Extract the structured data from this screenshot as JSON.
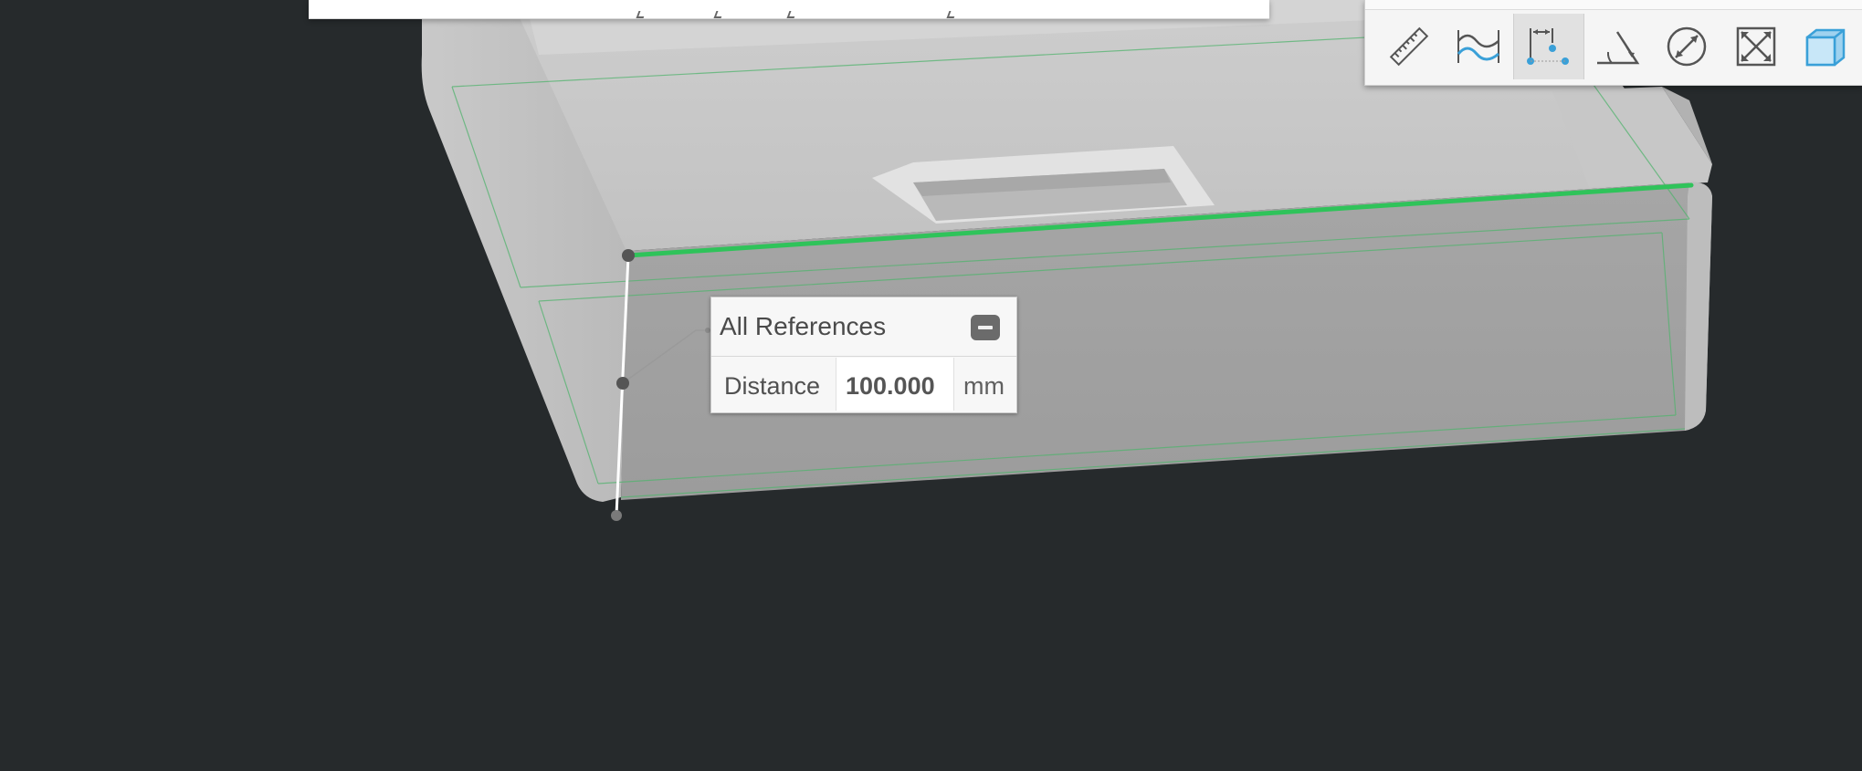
{
  "measure_panel": {
    "title": "All References",
    "distance_label": "Distance",
    "distance_value": "100.000",
    "distance_unit": "mm"
  },
  "toolbar": {
    "tools": [
      {
        "name": "ruler-tool",
        "icon": "ruler-icon"
      },
      {
        "name": "curve-measure-tool",
        "icon": "curve-icon"
      },
      {
        "name": "distance-measure-tool",
        "icon": "point-distance-icon",
        "active": true
      },
      {
        "name": "angle-measure-tool",
        "icon": "angle-icon"
      },
      {
        "name": "diameter-measure-tool",
        "icon": "diameter-icon"
      },
      {
        "name": "fit-view-tool",
        "icon": "fit-expand-icon"
      },
      {
        "name": "view-cube-tool",
        "icon": "cube-icon"
      }
    ]
  },
  "colors": {
    "background": "#262a2c",
    "model": "#b9b9b9",
    "selected_edge": "#2fc35a",
    "accent_blue": "#3aa0d8"
  }
}
